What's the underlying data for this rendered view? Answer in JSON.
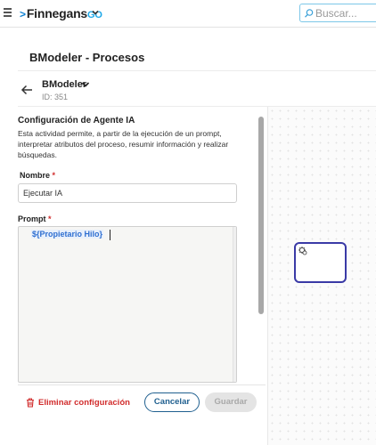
{
  "header": {
    "logo_main": "Finnegans",
    "logo_suffix": "GO",
    "search_placeholder": "Buscar..."
  },
  "page": {
    "title": "BModeler - Procesos"
  },
  "model": {
    "name": "BModeler",
    "id_text": "ID: 351"
  },
  "config": {
    "title": "Configuración de Agente IA",
    "description": "Esta actividad permite, a partir de la ejecución de un prompt, interpretar atributos del proceso, resumir información y realizar búsquedas.",
    "name_label": "Nombre",
    "required_mark": "*",
    "name_value": "Ejecutar IA",
    "prompt_label": "Prompt",
    "prompt_token": "${Propietario Hilo}"
  },
  "footer": {
    "delete_label": "Eliminar configuración",
    "cancel_label": "Cancelar",
    "save_label": "Guardar"
  },
  "colors": {
    "accent": "#1f5f8f",
    "danger": "#d12c2c",
    "task_border": "#3a3aa6"
  }
}
